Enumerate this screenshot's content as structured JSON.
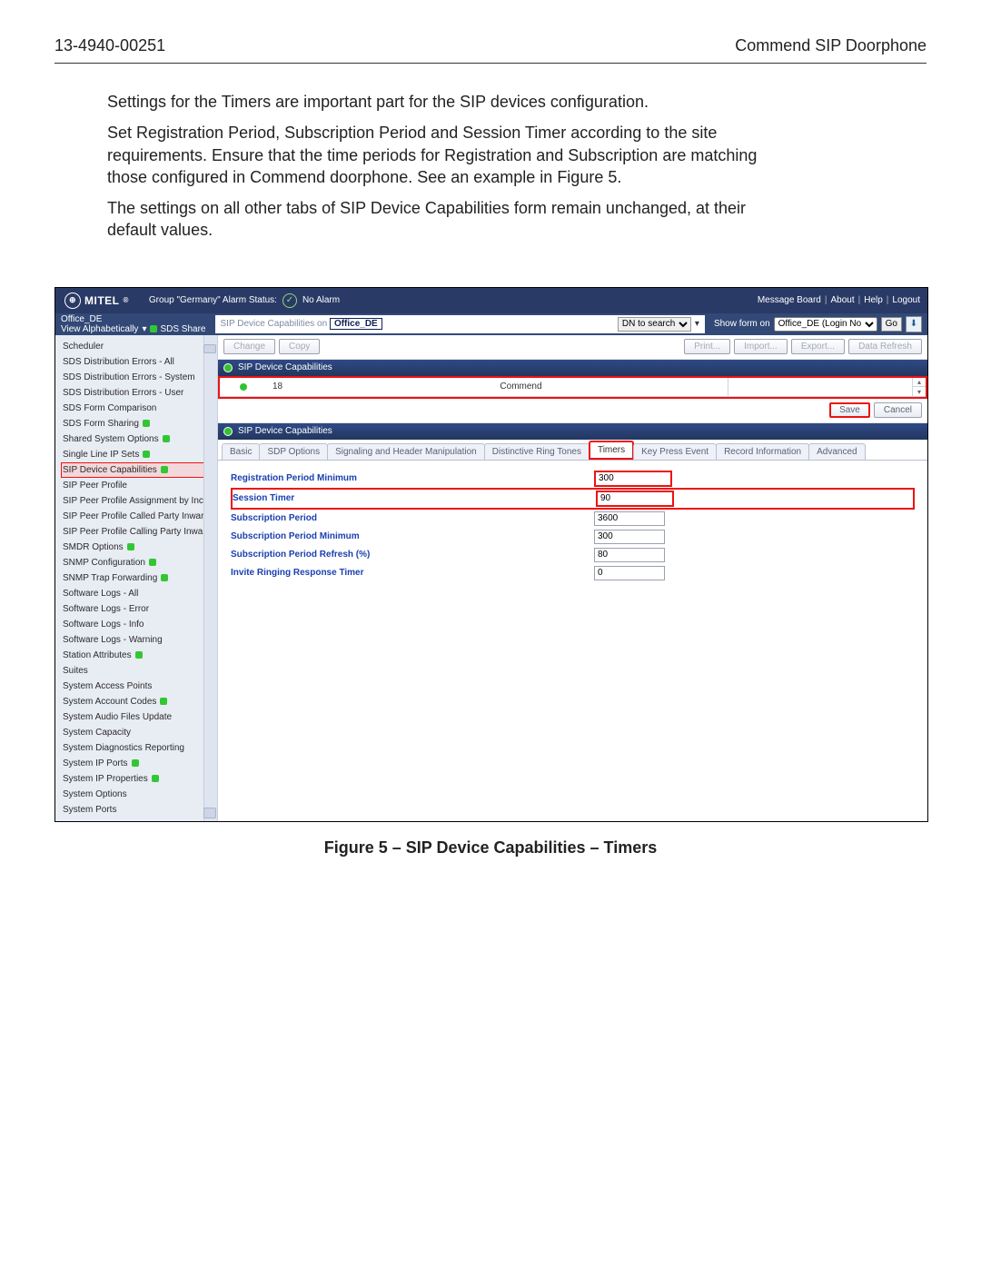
{
  "doc_header": {
    "left": "13-4940-00251",
    "right": "Commend SIP Doorphone"
  },
  "body": {
    "p1": "Settings for the Timers are important part for the SIP devices configuration.",
    "p2": "Set Registration Period, Subscription Period and Session Timer according to the site requirements. Ensure that the time periods for Registration and Subscription are matching those configured in Commend doorphone. See an example in Figure 5.",
    "p3": "The settings on all other tabs of SIP Device Capabilities form remain unchanged, at their default values."
  },
  "figure_caption": "Figure 5 – SIP Device Capabilities – Timers",
  "app": {
    "brand": "MITEL",
    "group_label": "Group \"Germany\" Alarm Status:",
    "alarm_status": "No Alarm",
    "top_links": [
      "Message Board",
      "About",
      "Help",
      "Logout"
    ],
    "office": "Office_DE",
    "view_label": "View Alphabetically",
    "sds_share": "SDS Share",
    "center_title_prefix": "SIP Device Capabilities on ",
    "center_title_node": "Office_DE",
    "dn_search": "DN to search",
    "show_form_label": "Show form on",
    "show_form_value": "Office_DE (Login No",
    "go": "Go",
    "toolbar": {
      "change": "Change",
      "copy": "Copy",
      "print": "Print...",
      "import": "Import...",
      "export": "Export...",
      "refresh": "Data Refresh"
    },
    "section_title": "SIP Device Capabilities",
    "data_row": {
      "num": "18",
      "name": "Commend"
    },
    "save": "Save",
    "cancel": "Cancel",
    "tabs": [
      "Basic",
      "SDP Options",
      "Signaling and Header Manipulation",
      "Distinctive Ring Tones",
      "Timers",
      "Key Press Event",
      "Record Information",
      "Advanced"
    ],
    "active_tab": 4,
    "form": [
      {
        "label": "Registration Period Minimum",
        "value": "300",
        "red": false
      },
      {
        "label": "Session Timer",
        "value": "90",
        "red": true
      },
      {
        "label": "Subscription Period",
        "value": "3600",
        "red": false
      },
      {
        "label": "Subscription Period Minimum",
        "value": "300",
        "red": false
      },
      {
        "label": "Subscription Period Refresh (%)",
        "value": "80",
        "red": false
      },
      {
        "label": "Invite Ringing Response Timer",
        "value": "0",
        "red": false
      }
    ],
    "sidebar_items": [
      {
        "t": "Scheduler"
      },
      {
        "t": "SDS Distribution Errors - All"
      },
      {
        "t": "SDS Distribution Errors - System"
      },
      {
        "t": "SDS Distribution Errors - User"
      },
      {
        "t": "SDS Form Comparison"
      },
      {
        "t": "SDS Form Sharing",
        "s": true
      },
      {
        "t": "Shared System Options",
        "s": true
      },
      {
        "t": "Single Line IP Sets",
        "s": true
      },
      {
        "t": "SIP Device Capabilities",
        "s": true,
        "sel": true
      },
      {
        "t": "SIP Peer Profile"
      },
      {
        "t": "SIP Peer Profile Assignment by Incom"
      },
      {
        "t": "SIP Peer Profile Called Party Inward D"
      },
      {
        "t": "SIP Peer Profile Calling Party Inward"
      },
      {
        "t": "SMDR Options",
        "s": true
      },
      {
        "t": "SNMP Configuration",
        "s": true
      },
      {
        "t": "SNMP Trap Forwarding",
        "s": true
      },
      {
        "t": "Software Logs - All"
      },
      {
        "t": "Software Logs - Error"
      },
      {
        "t": "Software Logs - Info"
      },
      {
        "t": "Software Logs - Warning"
      },
      {
        "t": "Station Attributes",
        "s": true
      },
      {
        "t": "Suites"
      },
      {
        "t": "System Access Points"
      },
      {
        "t": "System Account Codes",
        "s": true
      },
      {
        "t": "System Audio Files Update"
      },
      {
        "t": "System Capacity"
      },
      {
        "t": "System Diagnostics Reporting"
      },
      {
        "t": "System IP Ports",
        "s": true
      },
      {
        "t": "System IP Properties",
        "s": true
      },
      {
        "t": "System Options"
      },
      {
        "t": "System Ports"
      }
    ]
  }
}
